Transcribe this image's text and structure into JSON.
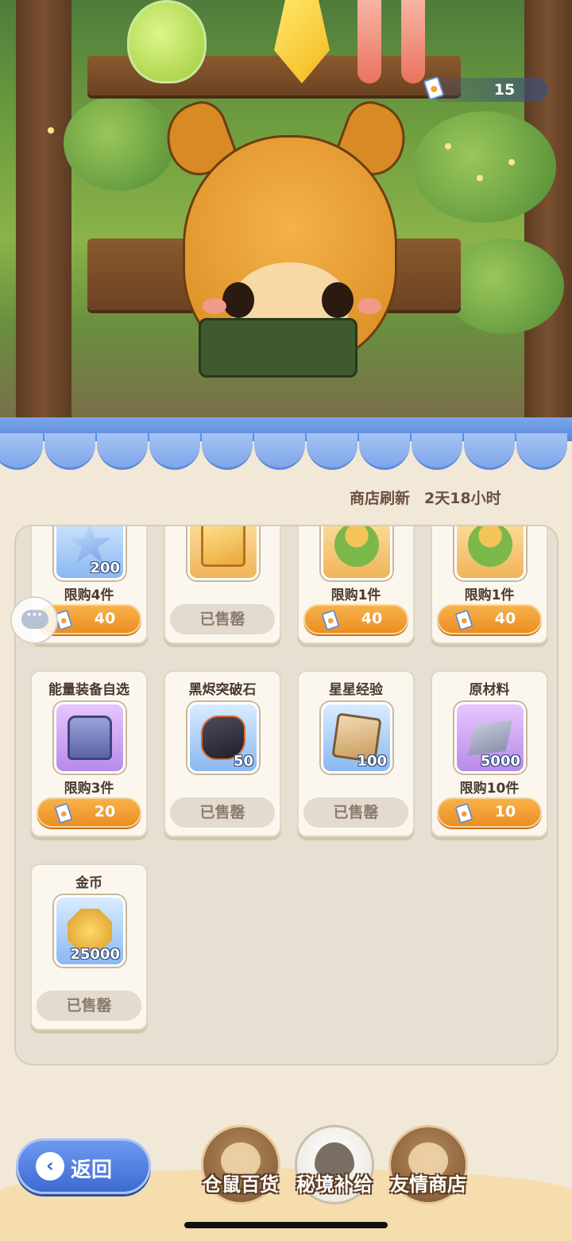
{
  "currency": {
    "icon": "ticket-icon",
    "count": "15"
  },
  "refresh": {
    "label": "商店刷新",
    "time": "2天18小时"
  },
  "colors": {
    "accent": "#ea8e22",
    "awning": "#7aa6ec",
    "panel": "#e7dfd1"
  },
  "rows": [
    [
      {
        "name": "",
        "icon": "star-crystal-icon",
        "qty": "200",
        "limit": "限购4件",
        "state": "buy",
        "price": "40"
      },
      {
        "name": "",
        "icon": "gold-ticket-icon",
        "qty": "",
        "limit": "",
        "state": "sold",
        "sold_label": "已售罄"
      },
      {
        "name": "",
        "icon": "plant-icon",
        "qty": "",
        "limit": "限购1件",
        "state": "buy",
        "price": "40"
      },
      {
        "name": "",
        "icon": "plant-icon",
        "qty": "",
        "limit": "限购1件",
        "state": "buy",
        "price": "40"
      }
    ],
    [
      {
        "name": "能量装备自选",
        "icon": "chest-icon",
        "qty": "",
        "limit": "限购3件",
        "state": "buy",
        "price": "20"
      },
      {
        "name": "黑烬突破石",
        "icon": "rock-icon",
        "qty": "50",
        "limit": "",
        "state": "sold",
        "sold_label": "已售罄"
      },
      {
        "name": "星星经验",
        "icon": "star-card-icon",
        "qty": "100",
        "limit": "",
        "state": "sold",
        "sold_label": "已售罄"
      },
      {
        "name": "原材料",
        "icon": "ingot-icon",
        "qty": "5000",
        "limit": "限购10件",
        "state": "buy",
        "price": "10"
      }
    ],
    [
      {
        "name": "金币",
        "icon": "gold-coin-icon",
        "qty": "25000",
        "limit": "",
        "state": "sold",
        "sold_label": "已售罄"
      }
    ]
  ],
  "back": {
    "label": "返回"
  },
  "tabs": [
    {
      "label": "仓鼠百货",
      "icon": "hamster-icon",
      "active": false
    },
    {
      "label": "秘境补给",
      "icon": "eye-icon",
      "active": true
    },
    {
      "label": "友情商店",
      "icon": "crystal-ball-icon",
      "active": false
    }
  ]
}
